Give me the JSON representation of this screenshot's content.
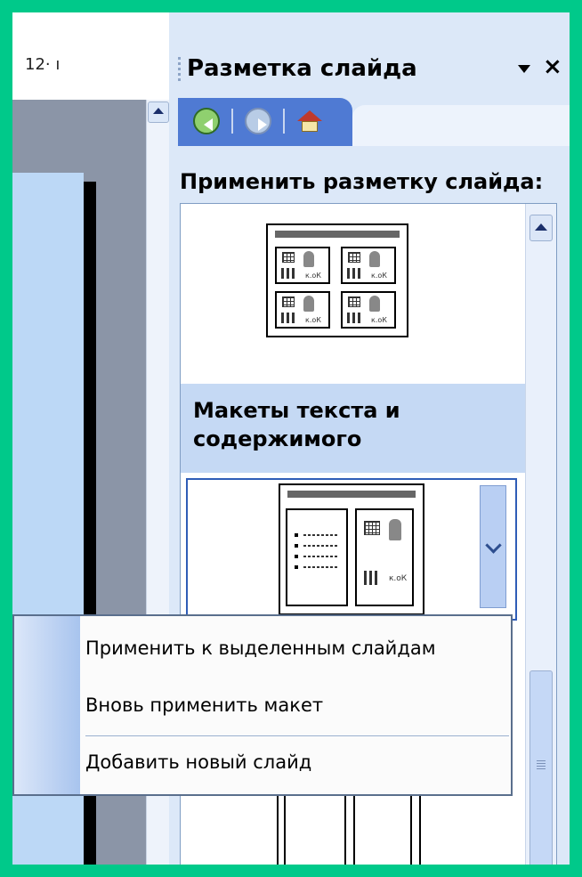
{
  "ruler": {
    "label": "12· ı"
  },
  "task_pane": {
    "title": "Разметка слайда",
    "apply_label": "Применить разметку слайда:",
    "section_title": "Макеты текста и содержимого"
  },
  "context_menu": {
    "items": [
      "Применить к выделенным слайдам",
      "Вновь применить макет",
      "Добавить новый слайд"
    ]
  },
  "colors": {
    "frame": "#00c98a",
    "nav_bar": "#4f7ad3",
    "pane_bg": "#dce8f8",
    "section_header": "#c5d9f4",
    "selection_border": "#2f5db7"
  }
}
